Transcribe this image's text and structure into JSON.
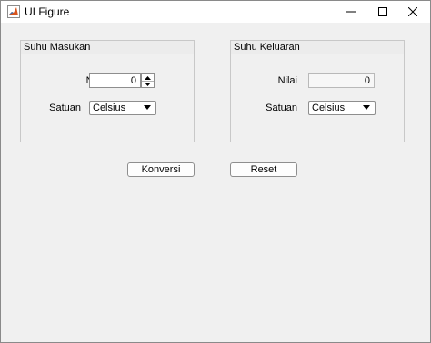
{
  "window": {
    "title": "UI Figure"
  },
  "input_panel": {
    "title": "Suhu Masukan",
    "value_label": "Nilai",
    "value": "0",
    "unit_label": "Satuan",
    "unit_selected": "Celsius"
  },
  "output_panel": {
    "title": "Suhu Keluaran",
    "value_label": "Nilai",
    "value": "0",
    "unit_label": "Satuan",
    "unit_selected": "Celsius"
  },
  "buttons": {
    "convert_label": "Konversi",
    "reset_label": "Reset"
  },
  "icons": {
    "app": "matlab-icon",
    "minimize": "minimize-icon",
    "maximize": "maximize-icon",
    "close": "close-icon"
  }
}
